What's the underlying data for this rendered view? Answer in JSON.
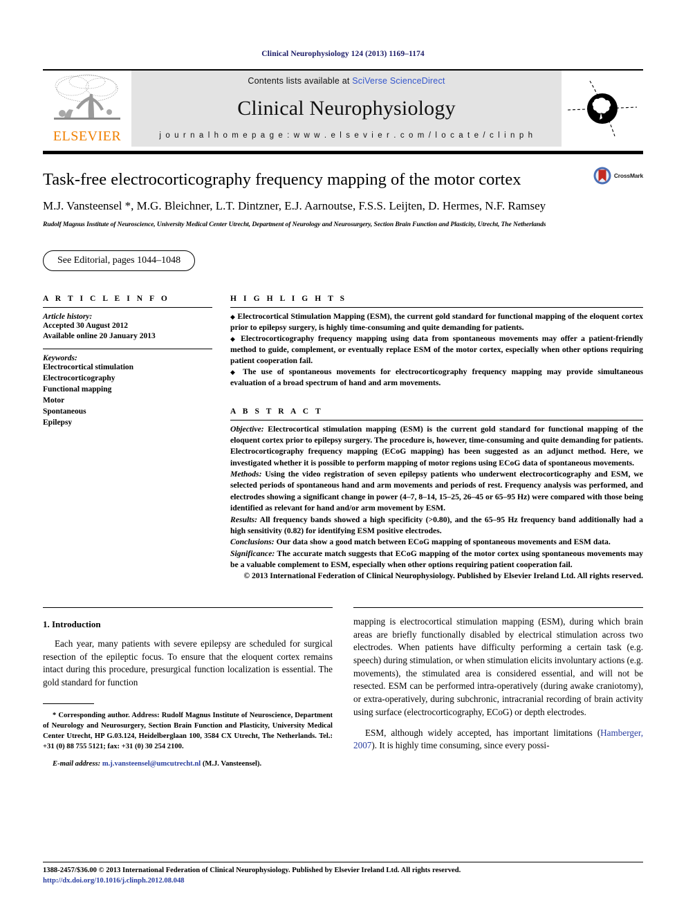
{
  "running_head": "Clinical Neurophysiology 124 (2013) 1169–1174",
  "masthead": {
    "publisher_name": "ELSEVIER",
    "contents_prefix": "Contents lists available at ",
    "sciencedirect_link": "SciVerse ScienceDirect",
    "journal_name": "Clinical Neurophysiology",
    "homepage_line": "j o u r n a l   h o m e p a g e :   w w w . e l s e v i e r . c o m / l o c a t e / c l i n p h"
  },
  "article": {
    "title": "Task-free electrocorticography frequency mapping of the motor cortex",
    "crossmark_label": "CrossMark",
    "authors": "M.J. Vansteensel *, M.G. Bleichner, L.T. Dintzner, E.J. Aarnoutse, F.S.S. Leijten, D. Hermes, N.F. Ramsey",
    "affiliation": "Rudolf Magnus Institute of Neuroscience, University Medical Center Utrecht, Department of Neurology and Neurosurgery, Section Brain Function and Plasticity, Utrecht, The Netherlands",
    "editorial_pill": "See Editorial, pages 1044–1048"
  },
  "article_info": {
    "heading": "A R T I C L E   I N F O",
    "history_label": "Article history:",
    "history_lines": [
      "Accepted 30 August 2012",
      "Available online 20 January 2013"
    ],
    "keywords_label": "Keywords:",
    "keywords": [
      "Electrocortical stimulation",
      "Electrocorticography",
      "Functional mapping",
      "Motor",
      "Spontaneous",
      "Epilepsy"
    ]
  },
  "highlights": {
    "heading": "H I G H L I G H T S",
    "items": [
      "Electrocortical Stimulation Mapping (ESM), the current gold standard for functional mapping of the eloquent cortex prior to epilepsy surgery, is highly time-consuming and quite demanding for patients.",
      "Electrocorticography frequency mapping using data from spontaneous movements may offer a patient-friendly method to guide, complement, or eventually replace ESM of the motor cortex, especially when other options requiring patient cooperation fail.",
      "The use of spontaneous movements for electrocorticography frequency mapping may provide simultaneous evaluation of a broad spectrum of hand and arm movements."
    ]
  },
  "abstract": {
    "heading": "A B S T R A C T",
    "sections": [
      {
        "label": "Objective:",
        "text": " Electrocortical stimulation mapping (ESM) is the current gold standard for functional mapping of the eloquent cortex prior to epilepsy surgery. The procedure is, however, time-consuming and quite demanding for patients. Electrocorticography frequency mapping (ECoG mapping) has been suggested as an adjunct method. Here, we investigated whether it is possible to perform mapping of motor regions using ECoG data of spontaneous movements."
      },
      {
        "label": "Methods:",
        "text": " Using the video registration of seven epilepsy patients who underwent electrocorticography and ESM, we selected periods of spontaneous hand and arm movements and periods of rest. Frequency analysis was performed, and electrodes showing a significant change in power (4–7, 8–14, 15–25, 26–45 or 65–95 Hz) were compared with those being identified as relevant for hand and/or arm movement by ESM."
      },
      {
        "label": "Results:",
        "text": "  All frequency bands showed a high specificity (>0.80), and the 65–95 Hz frequency band additionally had a high sensitivity (0.82) for identifying ESM positive electrodes."
      },
      {
        "label": "Conclusions:",
        "text": "  Our data show a good match between ECoG mapping of spontaneous movements and ESM data."
      },
      {
        "label": "Significance:",
        "text": " The accurate match suggests that ECoG mapping of the motor cortex using spontaneous movements may be a valuable complement to ESM, especially when other options requiring patient cooperation fail."
      }
    ],
    "copyright": "© 2013 International Federation of Clinical Neurophysiology. Published by Elsevier Ireland Ltd. All rights reserved."
  },
  "body": {
    "section_heading": "1. Introduction",
    "left_paragraph": "Each year, many patients with severe epilepsy are scheduled for surgical resection of the epileptic focus. To ensure that the eloquent cortex remains intact during this procedure, presurgical function localization is essential. The gold standard for function",
    "right_paragraph_1": "mapping is electrocortical stimulation mapping (ESM), during which brain areas are briefly functionally disabled by electrical stimulation across two electrodes. When patients have difficulty performing a certain task (e.g. speech) during stimulation, or when stimulation elicits involuntary actions (e.g. movements), the stimulated area is considered essential, and will not be resected. ESM can be performed intra-operatively (during awake craniotomy), or extra-operatively, during subchronic, intracranial recording of brain activity using surface (electrocorticography, ECoG) or depth electrodes.",
    "right_paragraph_2_pre": "ESM, although widely accepted, has important limitations (",
    "right_paragraph_2_cite": "Hamberger, 2007",
    "right_paragraph_2_post": "). It is highly time consuming, since every possi-"
  },
  "footnote": {
    "star": "*",
    "text": " Corresponding author. Address: Rudolf Magnus Institute of Neuroscience, Department of Neurology and Neurosurgery, Section Brain Function and Plasticity, University Medical Center Utrecht, HP G.03.124, Heidelberglaan 100, 3584 CX Utrecht, The Netherlands. Tel.: +31 (0) 88 755 5121; fax: +31 (0) 30 254 2100.",
    "email_label": "E-mail address:",
    "email": "m.j.vansteensel@umcutrecht.nl",
    "email_suffix": " (M.J. Vansteensel)."
  },
  "bottom": {
    "issn_line": "1388-2457/$36.00 © 2013 International Federation of Clinical Neurophysiology. Published by Elsevier Ireland Ltd. All rights reserved.",
    "doi_line": "http://dx.doi.org/10.1016/j.clinph.2012.08.048"
  },
  "colors": {
    "running_head": "#1a1a66",
    "link_blue": "#3355cc",
    "cite_blue": "#2b3fa0",
    "elsevier_orange": "#f08000",
    "band_gray": "#e3e3e3",
    "crossmark_red": "#c32a22",
    "crossmark_blue": "#4a6fb5"
  }
}
